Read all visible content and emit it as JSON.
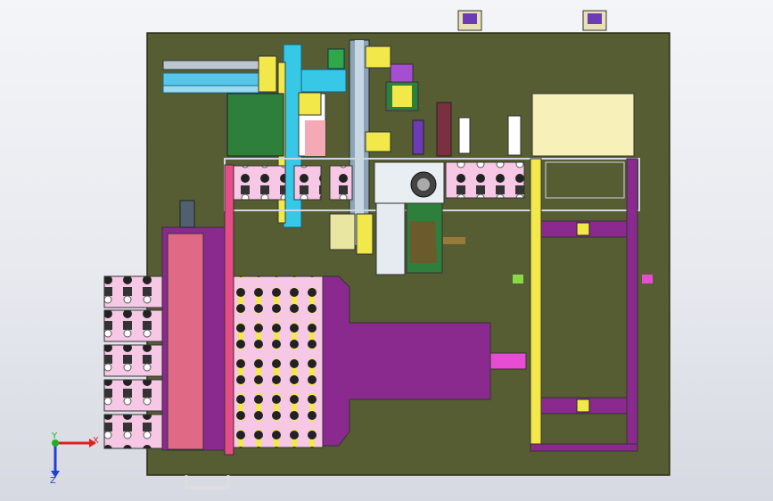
{
  "viewport": {
    "background_top": "#f4f5f8",
    "background_bottom": "#d6d9e1"
  },
  "colors": {
    "base_plate": "#565d32",
    "plate_edge": "#2a2d14",
    "magenta": "#e64d86",
    "purple": "#8a2a8f",
    "tray_pink": "#f7c7e6",
    "yellow": "#f2e84a",
    "cyan": "#37c8e8",
    "green": "#2f7f3c",
    "cream": "#f7f0b8"
  },
  "triad": {
    "x_label": "X",
    "z_label": "Z",
    "y_label": "Y",
    "x_color": "#e0201f",
    "z_color": "#2040d0",
    "y_color": "#1fae2d"
  },
  "icons": [
    "coordinate-triad-icon",
    "corner-marker-icon"
  ]
}
